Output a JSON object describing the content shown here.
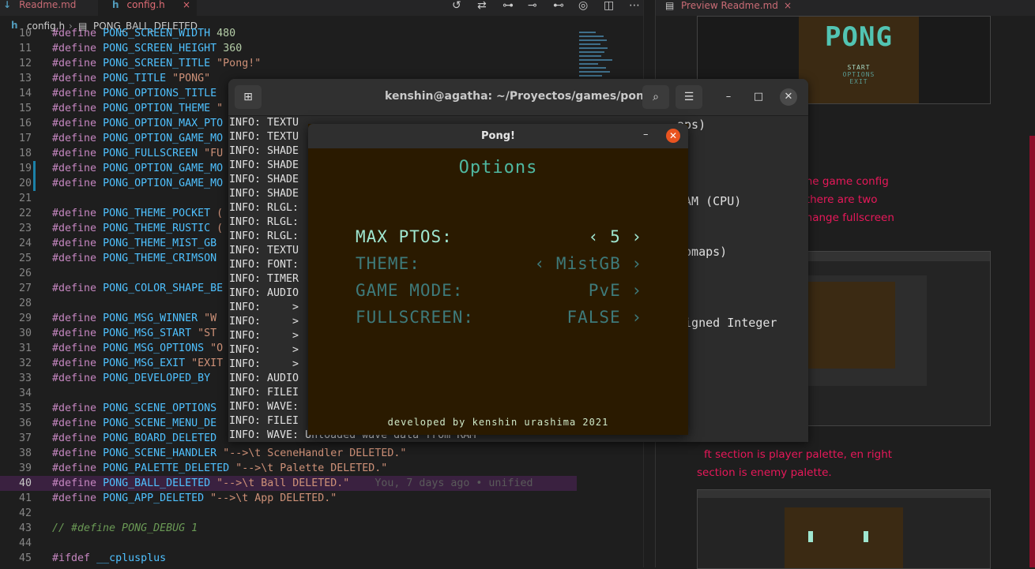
{
  "editor": {
    "tabs": [
      {
        "label": "Readme.md",
        "icon": "markdown-icon"
      },
      {
        "label": "config.h",
        "icon": "c-header-icon",
        "close": "×"
      }
    ],
    "breadcrumb": {
      "file": "config.h",
      "symbol": "PONG_BALL_DELETED"
    },
    "blame": "You, 7 days ago • unified"
  },
  "code_lines": [
    {
      "n": "10",
      "pre": "#define",
      "name": "PONG_SCREEN_WIDTH",
      "val": "480",
      "vt": "num"
    },
    {
      "n": "11",
      "pre": "#define",
      "name": "PONG_SCREEN_HEIGHT",
      "val": "360",
      "vt": "num"
    },
    {
      "n": "12",
      "pre": "#define",
      "name": "PONG_SCREEN_TITLE",
      "val": "\"Pong!\"",
      "vt": "str"
    },
    {
      "n": "13",
      "pre": "#define",
      "name": "PONG_TITLE",
      "val": "\"PONG\"",
      "vt": "str"
    },
    {
      "n": "14",
      "pre": "#define",
      "name": "PONG_OPTIONS_TITLE",
      "val": "",
      "vt": "str"
    },
    {
      "n": "15",
      "pre": "#define",
      "name": "PONG_OPTION_THEME",
      "val": "\"",
      "vt": "str"
    },
    {
      "n": "16",
      "pre": "#define",
      "name": "PONG_OPTION_MAX_PTO",
      "val": "",
      "vt": "str"
    },
    {
      "n": "17",
      "pre": "#define",
      "name": "PONG_OPTION_GAME_MO",
      "val": "",
      "vt": "str"
    },
    {
      "n": "18",
      "pre": "#define",
      "name": "PONG_FULLSCREEN",
      "val": "\"FU",
      "vt": "str"
    },
    {
      "n": "19",
      "pre": "#define",
      "name": "PONG_OPTION_GAME_MO",
      "val": "",
      "vt": "str"
    },
    {
      "n": "20",
      "pre": "#define",
      "name": "PONG_OPTION_GAME_MO",
      "val": "",
      "vt": "str"
    },
    {
      "n": "21",
      "pre": "",
      "name": "",
      "val": "",
      "vt": ""
    },
    {
      "n": "22",
      "pre": "#define",
      "name": "PONG_THEME_POCKET",
      "val": "(",
      "vt": "str"
    },
    {
      "n": "23",
      "pre": "#define",
      "name": "PONG_THEME_RUSTIC",
      "val": "(",
      "vt": "str"
    },
    {
      "n": "24",
      "pre": "#define",
      "name": "PONG_THEME_MIST_GB",
      "val": "",
      "vt": "str"
    },
    {
      "n": "25",
      "pre": "#define",
      "name": "PONG_THEME_CRIMSON",
      "val": "",
      "vt": "str"
    },
    {
      "n": "26",
      "pre": "",
      "name": "",
      "val": "",
      "vt": ""
    },
    {
      "n": "27",
      "pre": "#define",
      "name": "PONG_COLOR_SHAPE_BE",
      "val": "",
      "vt": "str"
    },
    {
      "n": "28",
      "pre": "",
      "name": "",
      "val": "",
      "vt": ""
    },
    {
      "n": "29",
      "pre": "#define",
      "name": "PONG_MSG_WINNER",
      "val": "\"W",
      "vt": "str"
    },
    {
      "n": "30",
      "pre": "#define",
      "name": "PONG_MSG_START",
      "val": "\"ST",
      "vt": "str"
    },
    {
      "n": "31",
      "pre": "#define",
      "name": "PONG_MSG_OPTIONS",
      "val": "\"O",
      "vt": "str"
    },
    {
      "n": "32",
      "pre": "#define",
      "name": "PONG_MSG_EXIT",
      "val": "\"EXIT",
      "vt": "str"
    },
    {
      "n": "33",
      "pre": "#define",
      "name": "PONG_DEVELOPED_BY",
      "val": "",
      "vt": "str"
    },
    {
      "n": "34",
      "pre": "",
      "name": "",
      "val": "",
      "vt": ""
    },
    {
      "n": "35",
      "pre": "#define",
      "name": "PONG_SCENE_OPTIONS",
      "val": "",
      "vt": "str"
    },
    {
      "n": "36",
      "pre": "#define",
      "name": "PONG_SCENE_MENU_DE",
      "val": "",
      "vt": "str"
    },
    {
      "n": "37",
      "pre": "#define",
      "name": "PONG_BOARD_DELETED",
      "val": "",
      "vt": "str"
    },
    {
      "n": "38",
      "pre": "#define",
      "name": "PONG_SCENE_HANDLER",
      "val": "\"-->\\t SceneHandler DELETED.\"",
      "vt": "str"
    },
    {
      "n": "39",
      "pre": "#define",
      "name": "PONG_PALETTE_DELETED",
      "val": "\"-->\\t Palette DELETED.\"",
      "vt": "str"
    },
    {
      "n": "40",
      "pre": "#define",
      "name": "PONG_BALL_DELETED",
      "val": "\"-->\\t Ball DELETED.\"",
      "vt": "str"
    },
    {
      "n": "41",
      "pre": "#define",
      "name": "PONG_APP_DELETED",
      "val": "\"-->\\t App DELETED.\"",
      "vt": "str"
    },
    {
      "n": "42",
      "pre": "",
      "name": "",
      "val": "",
      "vt": ""
    },
    {
      "n": "43",
      "pre": "// #define PONG_DEBUG 1",
      "name": "",
      "val": "",
      "vt": "cmt"
    },
    {
      "n": "44",
      "pre": "",
      "name": "",
      "val": "",
      "vt": ""
    },
    {
      "n": "45",
      "pre": "#ifdef",
      "name": "__cplusplus",
      "val": "",
      "vt": ""
    }
  ],
  "terminal": {
    "title": "kenshin@agatha: ~/Proyectos/games/pong",
    "lines": [
      "INFO: TEXTU",
      "INFO: TEXTU",
      "INFO: SHADE",
      "INFO: SHADE",
      "INFO: SHADE",
      "INFO: SHADE",
      "INFO: RLGL:",
      "INFO: RLGL:",
      "INFO: RLGL:",
      "INFO: TEXTU",
      "INFO: FONT:",
      "INFO: TIMER",
      "INFO: AUDIO",
      "INFO:     >",
      "INFO:     >",
      "INFO:     >",
      "INFO:     >",
      "INFO:     >",
      "INFO: AUDIO",
      "INFO: FILEI",
      "INFO: WAVE:",
      "INFO: FILEI",
      "INFO: WAVE: Unloaded wave data from RAM"
    ],
    "right_fragments": [
      "aps)",
      "RAM (CPU)",
      "ipmaps)",
      "signed Integer"
    ],
    "top_fragment": "INFO: TEXTURE ... mipmaps)"
  },
  "pong": {
    "window_title": "Pong!",
    "heading": "Options",
    "options": [
      {
        "label": "MAX PTOS:",
        "value": "‹ 5 ›",
        "selected": true
      },
      {
        "label": "THEME:",
        "value": "‹ MistGB ›",
        "selected": false
      },
      {
        "label": "GAME MODE:",
        "value": "PvE ›",
        "selected": false
      },
      {
        "label": "FULLSCREEN:",
        "value": "FALSE ›",
        "selected": false
      }
    ],
    "footer": "developed by kenshin urashima 2021",
    "palette": {
      "bg": "#2a1a00",
      "selected": "#9fe6d0",
      "normal": "#3e7a7a",
      "heading": "#4fb8a0"
    }
  },
  "preview": {
    "tab_label": "Preview Readme.md",
    "close": "×",
    "text_blocks": [
      "tions for modified the game config",
      "eme, game mode (there are two",
      "d as well you can change fullscreen",
      "ft section is player palette, en right",
      "section is enemy palette."
    ],
    "thumb_logo": "PONG",
    "thumb_menu": [
      "START",
      "OPTIONS",
      "EXIT"
    ]
  }
}
